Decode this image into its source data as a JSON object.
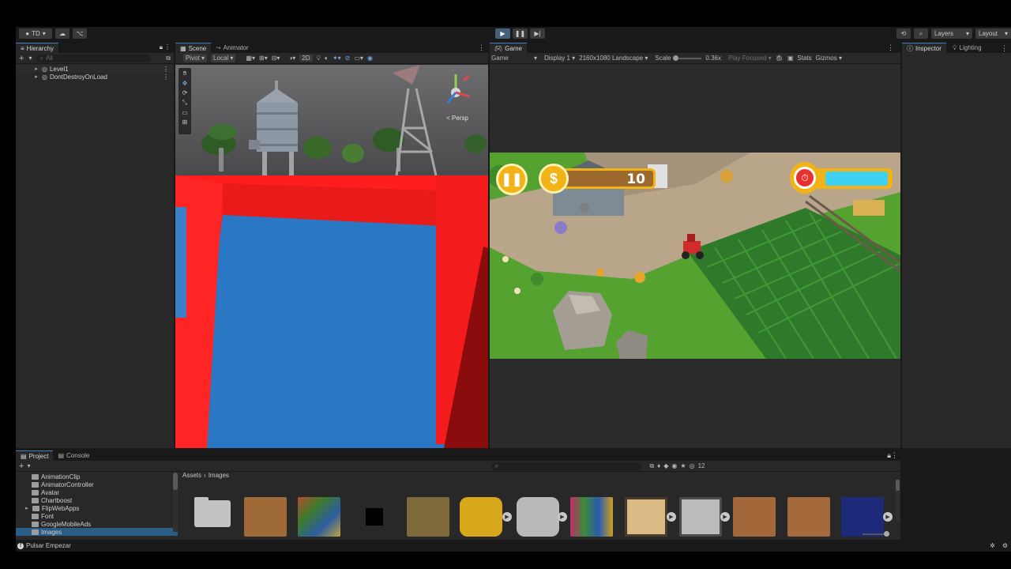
{
  "toolbar": {
    "account_label": "TD",
    "layers_label": "Layers",
    "layout_label": "Layout"
  },
  "hierarchy": {
    "tab_label": "Hierarchy",
    "search_placeholder": "All",
    "items": [
      {
        "label": "Level1"
      },
      {
        "label": "DontDestroyOnLoad"
      }
    ]
  },
  "scene": {
    "tab_scene": "Scene",
    "tab_animator": "Animator",
    "pivot_label": "Pivot",
    "local_label": "Local",
    "mode_2d": "2D",
    "persp_label": "Persp"
  },
  "game": {
    "tab_label": "Game",
    "view_label": "Game",
    "display_label": "Display 1",
    "resolution_label": "2160x1080 Landscape",
    "scale_label": "Scale",
    "scale_value": "0.36x",
    "play_focused_label": "Play Focused",
    "stats_label": "Stats",
    "gizmos_label": "Gizmos",
    "hud": {
      "coins_value": "10",
      "timer_fill": 1.0
    }
  },
  "inspector": {
    "tab_inspector": "Inspector",
    "tab_lighting": "Lighting"
  },
  "project": {
    "tab_project": "Project",
    "tab_console": "Console",
    "breadcrumb": [
      "Assets",
      "Images"
    ],
    "folders": [
      {
        "label": "AnimationClip"
      },
      {
        "label": "AnimatorController"
      },
      {
        "label": "Avatar"
      },
      {
        "label": "Chartboost"
      },
      {
        "label": "FlipWebApps"
      },
      {
        "label": "Font"
      },
      {
        "label": "GoogleMobileAds"
      },
      {
        "label": "Images"
      }
    ],
    "hidden_count": "12"
  },
  "status": {
    "message": "Pulsar Empezar"
  },
  "colors": {
    "accent": "#3c7fc7",
    "play_button": "#46607c",
    "panel_bg": "#282828",
    "window_bg": "#191919",
    "grass": "#4f9a2c",
    "hud_gold": "#f2b316",
    "timer_bar": "#3fd2f0"
  }
}
